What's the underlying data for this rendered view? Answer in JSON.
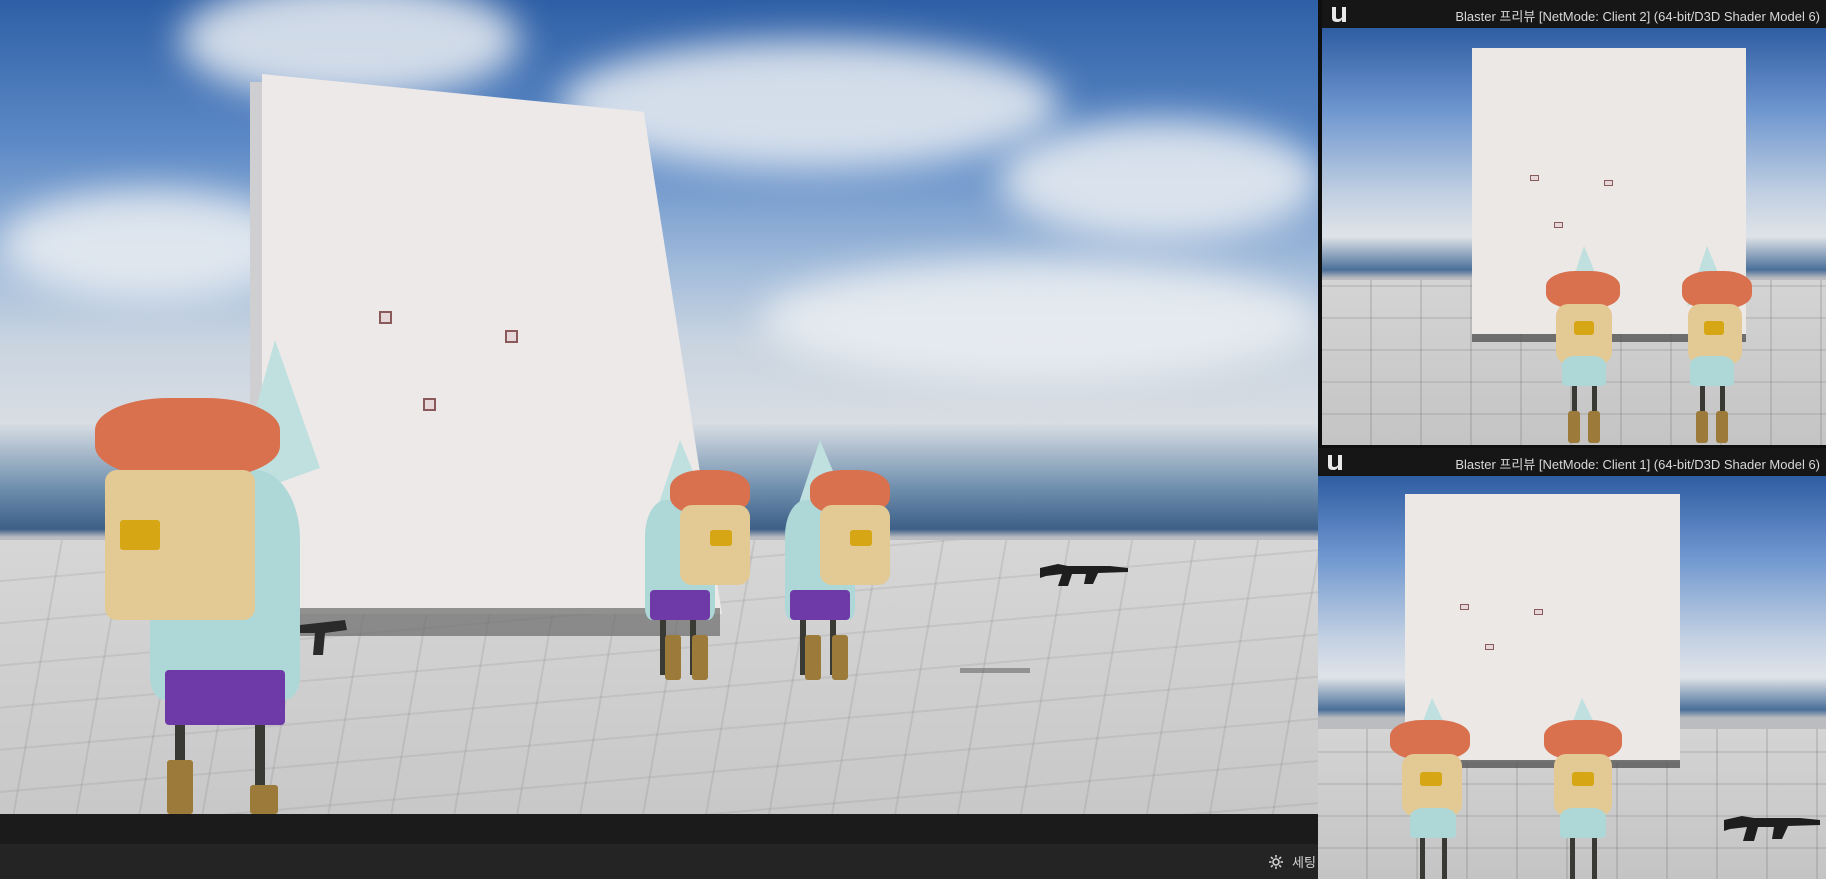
{
  "window_title_client2": "Blaster 프리뷰 [NetMode: Client 2]  (64-bit/D3D Shader Model 6)",
  "window_title_client1": "Blaster 프리뷰 [NetMode: Client 1]  (64-bit/D3D Shader Model 6)",
  "bottom_bar": {
    "settings_label": "세팅",
    "settings_icon": "gear-icon"
  },
  "icons": {
    "engine_logo": "unreal-logo-icon"
  },
  "colors": {
    "title_bar_bg": "#161616",
    "status_bar_bg": "#1b1b1b",
    "bottom_bar_bg": "#242424",
    "title_text": "#d8d8d8"
  }
}
